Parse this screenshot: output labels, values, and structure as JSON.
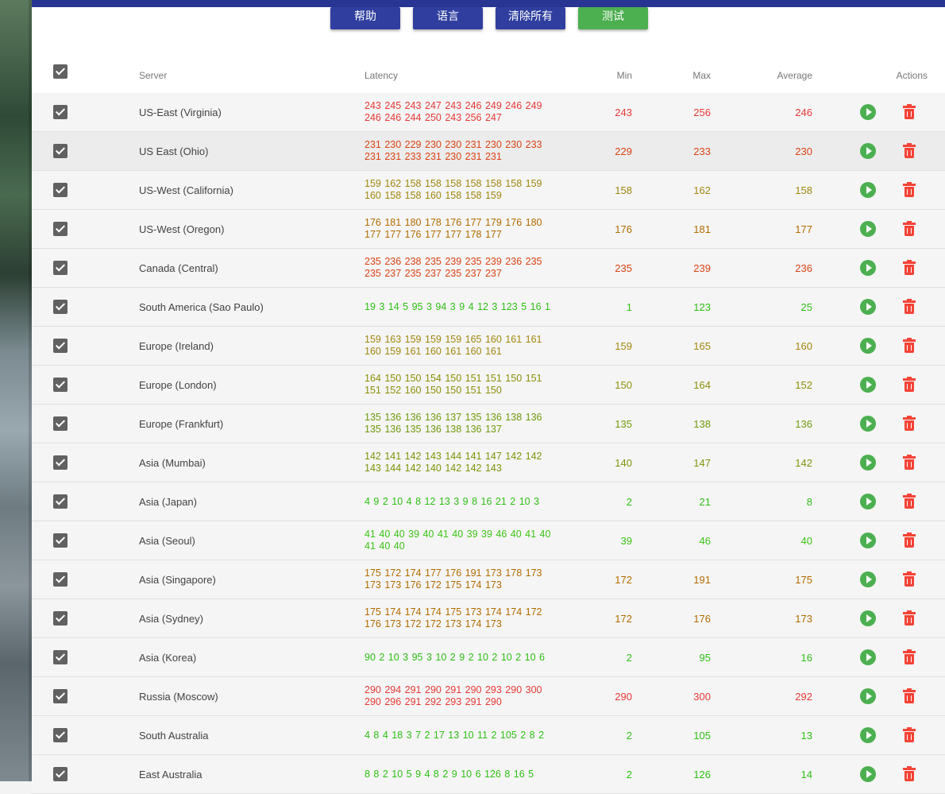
{
  "toolbar": {
    "help_label": "帮助",
    "language_label": "语言",
    "clear_all_label": "清除所有",
    "test_label": "测试"
  },
  "table": {
    "headers": {
      "server": "Server",
      "latency": "Latency",
      "min": "Min",
      "max": "Max",
      "average": "Average",
      "actions": "Actions"
    },
    "rows": [
      {
        "server": "US-East (Virginia)",
        "latency": "243 245 243 247 243 246 249 246 249 246 246 244 250 243 256 247",
        "min": "243",
        "max": "256",
        "average": "246",
        "color": "#e53935",
        "checked": true
      },
      {
        "server": "US East (Ohio)",
        "latency": "231 230 229 230 230 231 230 230 233 231 231 233 231 230 231 231",
        "min": "229",
        "max": "233",
        "average": "230",
        "color": "#d84315",
        "checked": true
      },
      {
        "server": "US-West (California)",
        "latency": "159 162 158 158 158 158 158 158 159 160 158 158 160 158 158 159",
        "min": "158",
        "max": "162",
        "average": "158",
        "color": "#a1870f",
        "checked": true
      },
      {
        "server": "US-West (Oregon)",
        "latency": "176 181 180 178 176 177 179 176 180 177 177 176 177 177 178 177",
        "min": "176",
        "max": "181",
        "average": "177",
        "color": "#b36b00",
        "checked": true
      },
      {
        "server": "Canada (Central)",
        "latency": "235 236 238 235 239 235 239 236 235 235 237 235 237 235 237 237",
        "min": "235",
        "max": "239",
        "average": "236",
        "color": "#d84315",
        "checked": true
      },
      {
        "server": "South America (Sao Paulo)",
        "latency": "19 3 14 5 95 3 94 3 9 4 12 3 123 5 16 1",
        "min": "1",
        "max": "123",
        "average": "25",
        "color": "#2ebf14",
        "checked": true
      },
      {
        "server": "Europe (Ireland)",
        "latency": "159 163 159 159 159 165 160 161 161 160 159 161 160 161 160 161",
        "min": "159",
        "max": "165",
        "average": "160",
        "color": "#a1870f",
        "checked": true
      },
      {
        "server": "Europe (London)",
        "latency": "164 150 150 154 150 151 151 150 151 151 152 160 150 150 151 150",
        "min": "150",
        "max": "164",
        "average": "152",
        "color": "#8c8f08",
        "checked": true
      },
      {
        "server": "Europe (Frankfurt)",
        "latency": "135 136 136 136 137 135 136 138 136 135 136 135 136 138 136 137",
        "min": "135",
        "max": "138",
        "average": "136",
        "color": "#6f9a0c",
        "checked": true
      },
      {
        "server": "Asia (Mumbai)",
        "latency": "142 141 142 143 144 141 147 142 142 143 144 142 140 142 142 143",
        "min": "140",
        "max": "147",
        "average": "142",
        "color": "#7d940a",
        "checked": true
      },
      {
        "server": "Asia (Japan)",
        "latency": "4 9 2 10 4 8 12 13 3 9 8 16 21 2 10 3",
        "min": "2",
        "max": "21",
        "average": "8",
        "color": "#2ebf14",
        "checked": true
      },
      {
        "server": "Asia (Seoul)",
        "latency": "41 40 40 39 40 41 40 39 39 46 40 41 40 41 40 40",
        "min": "39",
        "max": "46",
        "average": "40",
        "color": "#3cc414",
        "checked": true
      },
      {
        "server": "Asia (Singapore)",
        "latency": "175 172 174 177 176 191 173 178 173 173 173 176 172 175 174 173",
        "min": "172",
        "max": "191",
        "average": "175",
        "color": "#b36b00",
        "checked": true
      },
      {
        "server": "Asia (Sydney)",
        "latency": "175 174 174 174 175 173 174 174 172 176 173 172 172 173 174 173",
        "min": "172",
        "max": "176",
        "average": "173",
        "color": "#b36b00",
        "checked": true
      },
      {
        "server": "Asia (Korea)",
        "latency": "90 2 10 3 95 3 10 2 9 2 10 2 10 2 10 6",
        "min": "2",
        "max": "95",
        "average": "16",
        "color": "#2ebf14",
        "checked": true
      },
      {
        "server": "Russia (Moscow)",
        "latency": "290 294 291 290 291 290 293 290 300 290 296 291 292 293 291 290",
        "min": "290",
        "max": "300",
        "average": "292",
        "color": "#e53935",
        "checked": true
      },
      {
        "server": "South Australia",
        "latency": "4 8 4 18 3 7 2 17 13 10 11 2 105 2 8 2",
        "min": "2",
        "max": "105",
        "average": "13",
        "color": "#2ebf14",
        "checked": true
      },
      {
        "server": "East Australia",
        "latency": "8 8 2 10 5 9 4 8 2 9 10 6 126 8 16 5",
        "min": "2",
        "max": "126",
        "average": "14",
        "color": "#2ebf14",
        "checked": true
      }
    ]
  },
  "icons": {
    "play": "play-circle-icon",
    "delete": "trash-icon",
    "checkbox": "checkbox-checked-icon"
  },
  "colors": {
    "primary": "#303f9f",
    "topbar": "#283593",
    "test": "#4caf50",
    "delete": "#f44336",
    "checkbox": "#616161"
  }
}
